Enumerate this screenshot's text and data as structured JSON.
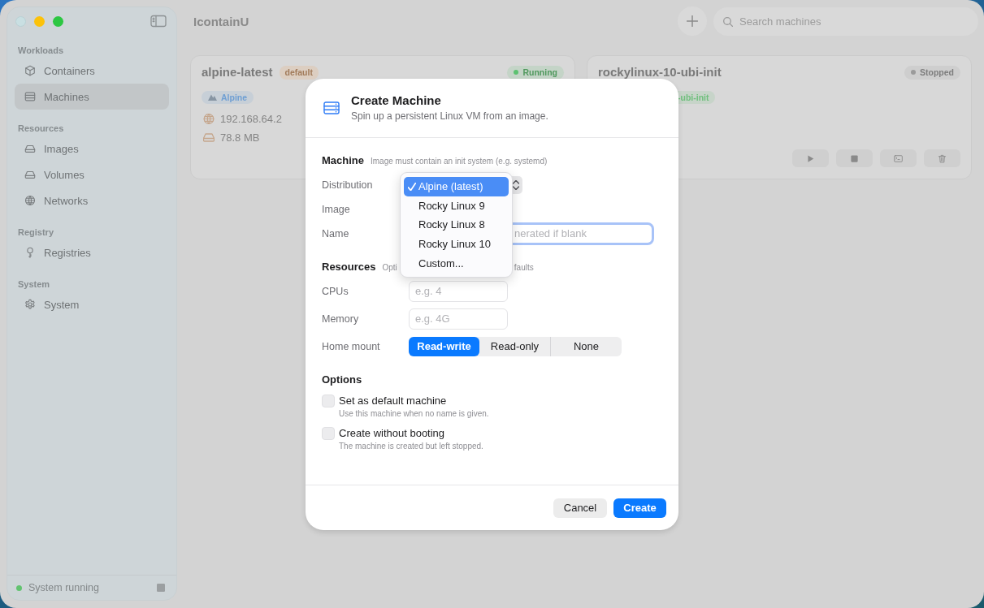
{
  "window": {
    "title": "IcontainU"
  },
  "sidebar": {
    "sections": [
      {
        "heading": "Workloads",
        "items": [
          {
            "label": "Containers",
            "selected": false
          },
          {
            "label": "Machines",
            "selected": true
          }
        ]
      },
      {
        "heading": "Resources",
        "items": [
          {
            "label": "Images",
            "selected": false
          },
          {
            "label": "Volumes",
            "selected": false
          },
          {
            "label": "Networks",
            "selected": false
          }
        ]
      },
      {
        "heading": "Registry",
        "items": [
          {
            "label": "Registries",
            "selected": false
          }
        ]
      },
      {
        "heading": "System",
        "items": [
          {
            "label": "System",
            "selected": false
          }
        ]
      }
    ],
    "status": {
      "label": "System running",
      "running": true
    }
  },
  "toolbar": {
    "search": {
      "placeholder": "Search machines"
    }
  },
  "machines": [
    {
      "name": "alpine-latest",
      "badge": "default",
      "status": {
        "label": "Running",
        "color": "#5cc270"
      },
      "tag": {
        "label": "Alpine",
        "color": "#6f9fd3"
      },
      "details": [
        "192.168.64.2",
        "78.8 MB"
      ]
    },
    {
      "name": "rockylinux-10-ubi-init",
      "status": {
        "label": "Stopped",
        "color": "#9b9b9b"
      },
      "tag": {
        "label": "-ubi-init",
        "color": "#6fbf7c"
      },
      "actions": true
    }
  ],
  "dialog": {
    "title": "Create Machine",
    "subtitle": "Spin up a persistent Linux VM from an image.",
    "sections": [
      {
        "heading": "Machine",
        "hint": [
          "Image must contain an init system (e.g. systemd)"
        ],
        "fields": [
          {
            "kind": "popup",
            "label": "Distribution",
            "menu": [
              {
                "label": "Alpine (latest)",
                "selected": true
              },
              {
                "label": "Rocky Linux 9",
                "selected": false
              },
              {
                "label": "Rocky Linux 8",
                "selected": false
              },
              {
                "label": "Rocky Linux 10",
                "selected": false
              },
              {
                "label": "Custom...",
                "selected": false
              }
            ]
          },
          {
            "kind": "covered",
            "label": "Image"
          },
          {
            "kind": "text",
            "label": "Name",
            "placeholder": "nerated if blank",
            "focused": true
          }
        ]
      },
      {
        "heading": "Resources",
        "hint": [
          "Opti",
          "faults"
        ],
        "fields": [
          {
            "kind": "text",
            "label": "CPUs",
            "placeholder": "e.g. 4",
            "focused": false
          },
          {
            "kind": "text",
            "label": "Memory",
            "placeholder": "e.g. 4G",
            "focused": false
          },
          {
            "kind": "segmented",
            "label": "Home mount",
            "options": [
              {
                "label": "Read-write",
                "selected": true
              },
              {
                "label": "Read-only",
                "selected": false
              },
              {
                "label": "None",
                "selected": false
              }
            ]
          }
        ]
      },
      {
        "heading": "Options",
        "checkboxes": [
          {
            "label": "Set as default machine",
            "description": "Use this machine when no name is given.",
            "checked": false
          },
          {
            "label": "Create without booting",
            "description": "The machine is created but left stopped.",
            "checked": false
          }
        ]
      }
    ],
    "buttons": [
      {
        "label": "Cancel",
        "kind": "secondary"
      },
      {
        "label": "Create",
        "kind": "primary"
      }
    ]
  }
}
